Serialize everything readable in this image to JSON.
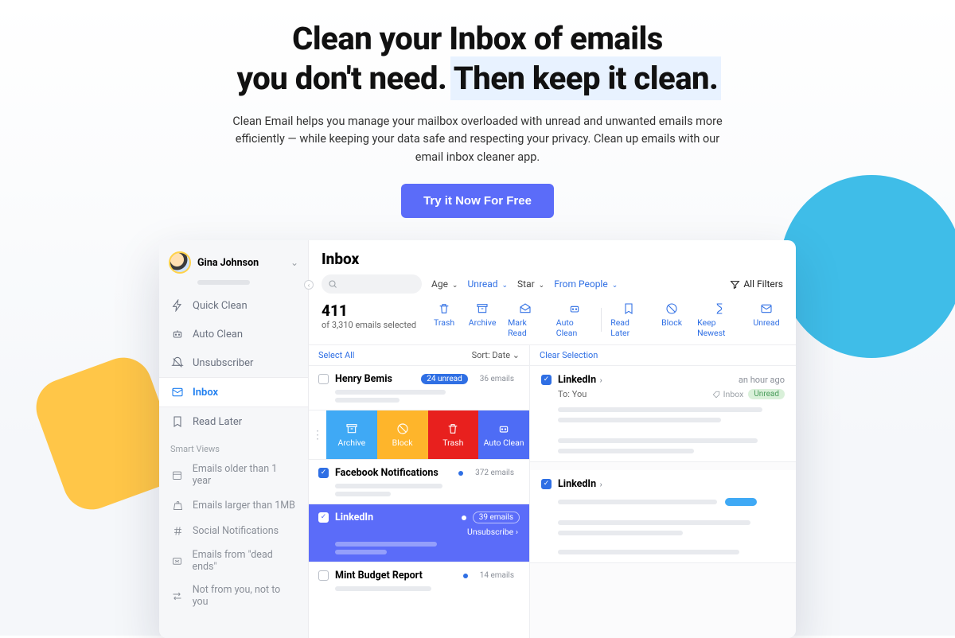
{
  "hero": {
    "line1": "Clean your Inbox of emails",
    "line2a": "you don't need. ",
    "line2b": "Then keep it clean.",
    "description": "Clean Email helps you manage your mailbox overloaded with unread and unwanted emails more efficiently — while keeping your data safe and respecting your privacy. Clean up emails with our email inbox cleaner app.",
    "cta": "Try it Now For Free"
  },
  "sidebar": {
    "user": "Gina Johnson",
    "nav": [
      {
        "label": "Quick Clean"
      },
      {
        "label": "Auto Clean"
      },
      {
        "label": "Unsubscriber"
      },
      {
        "label": "Inbox"
      },
      {
        "label": "Read Later"
      }
    ],
    "smart_label": "Smart Views",
    "smart": [
      {
        "label": "Emails older than 1 year"
      },
      {
        "label": "Emails larger than 1MB"
      },
      {
        "label": "Social Notifications"
      },
      {
        "label": "Emails from \"dead ends\""
      },
      {
        "label": "Not from you, not to you"
      }
    ]
  },
  "inbox": {
    "title": "Inbox",
    "filters": {
      "age": "Age",
      "unread": "Unread",
      "star": "Star",
      "from": "From People",
      "all": "All Filters"
    },
    "count": "411",
    "count_sub": "of 3,310 emails selected",
    "actions": [
      "Trash",
      "Archive",
      "Mark Read",
      "Auto Clean",
      "Read Later",
      "Block",
      "Keep Newest",
      "Unread"
    ],
    "select_all": "Select All",
    "sort": "Sort: Date",
    "clear": "Clear Selection",
    "groups": [
      {
        "name": "Henry Bemis",
        "unread": "24 unread",
        "count": "36 emails"
      },
      {
        "name": "Facebook Notifications",
        "count": "372 emails"
      },
      {
        "name": "LinkedIn",
        "count": "39 emails",
        "unsub": "Unsubscribe"
      },
      {
        "name": "Mint Budget Report",
        "count": "14 emails"
      }
    ],
    "swipe": {
      "archive": "Archive",
      "block": "Block",
      "trash": "Trash",
      "auto": "Auto Clean"
    },
    "preview": {
      "title": "LinkedIn",
      "time": "an hour ago",
      "to_label": "To:",
      "to_value": "You",
      "folder": "Inbox",
      "status": "Unread"
    },
    "preview2": {
      "title": "LinkedIn"
    }
  }
}
